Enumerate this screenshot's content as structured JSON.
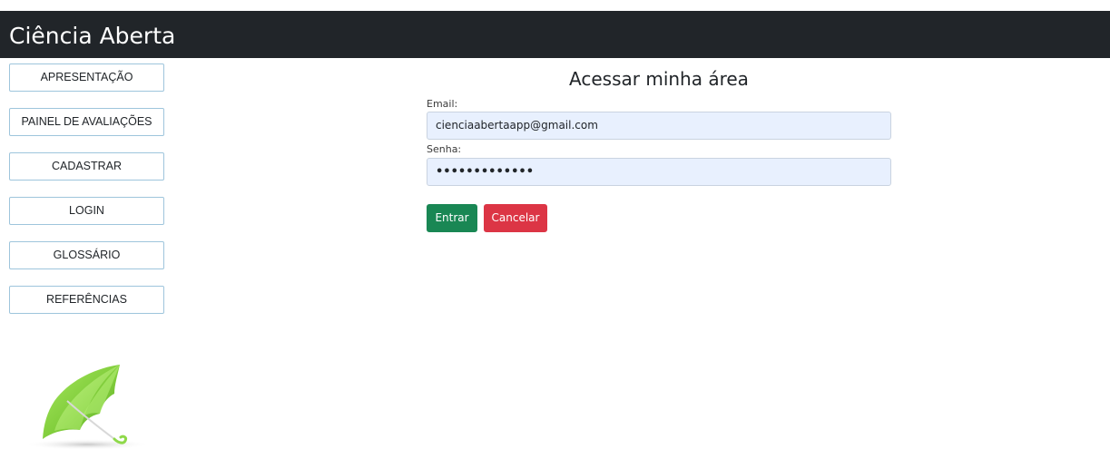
{
  "app": {
    "title": "Ciência Aberta"
  },
  "sidebar": {
    "items": [
      {
        "label": "APRESENTAÇÃO"
      },
      {
        "label": "PAINEL DE AVALIAÇÕES"
      },
      {
        "label": "CADASTRAR"
      },
      {
        "label": "LOGIN"
      },
      {
        "label": "GLOSSÁRIO"
      },
      {
        "label": "REFERÊNCIAS"
      }
    ],
    "logo_icon": "green-umbrella-icon"
  },
  "login_form": {
    "title": "Acessar minha área",
    "email_label": "Email:",
    "email_value": "cienciaabertaapp@gmail.com",
    "password_label": "Senha:",
    "password_value": "•••••••••••••",
    "submit_label": "Entrar",
    "cancel_label": "Cancelar"
  },
  "colors": {
    "header_bg": "#212529",
    "submit_bg": "#198754",
    "cancel_bg": "#dc3545",
    "autofill_bg": "#e8f0fe",
    "nav_border": "#9ec5dc"
  }
}
